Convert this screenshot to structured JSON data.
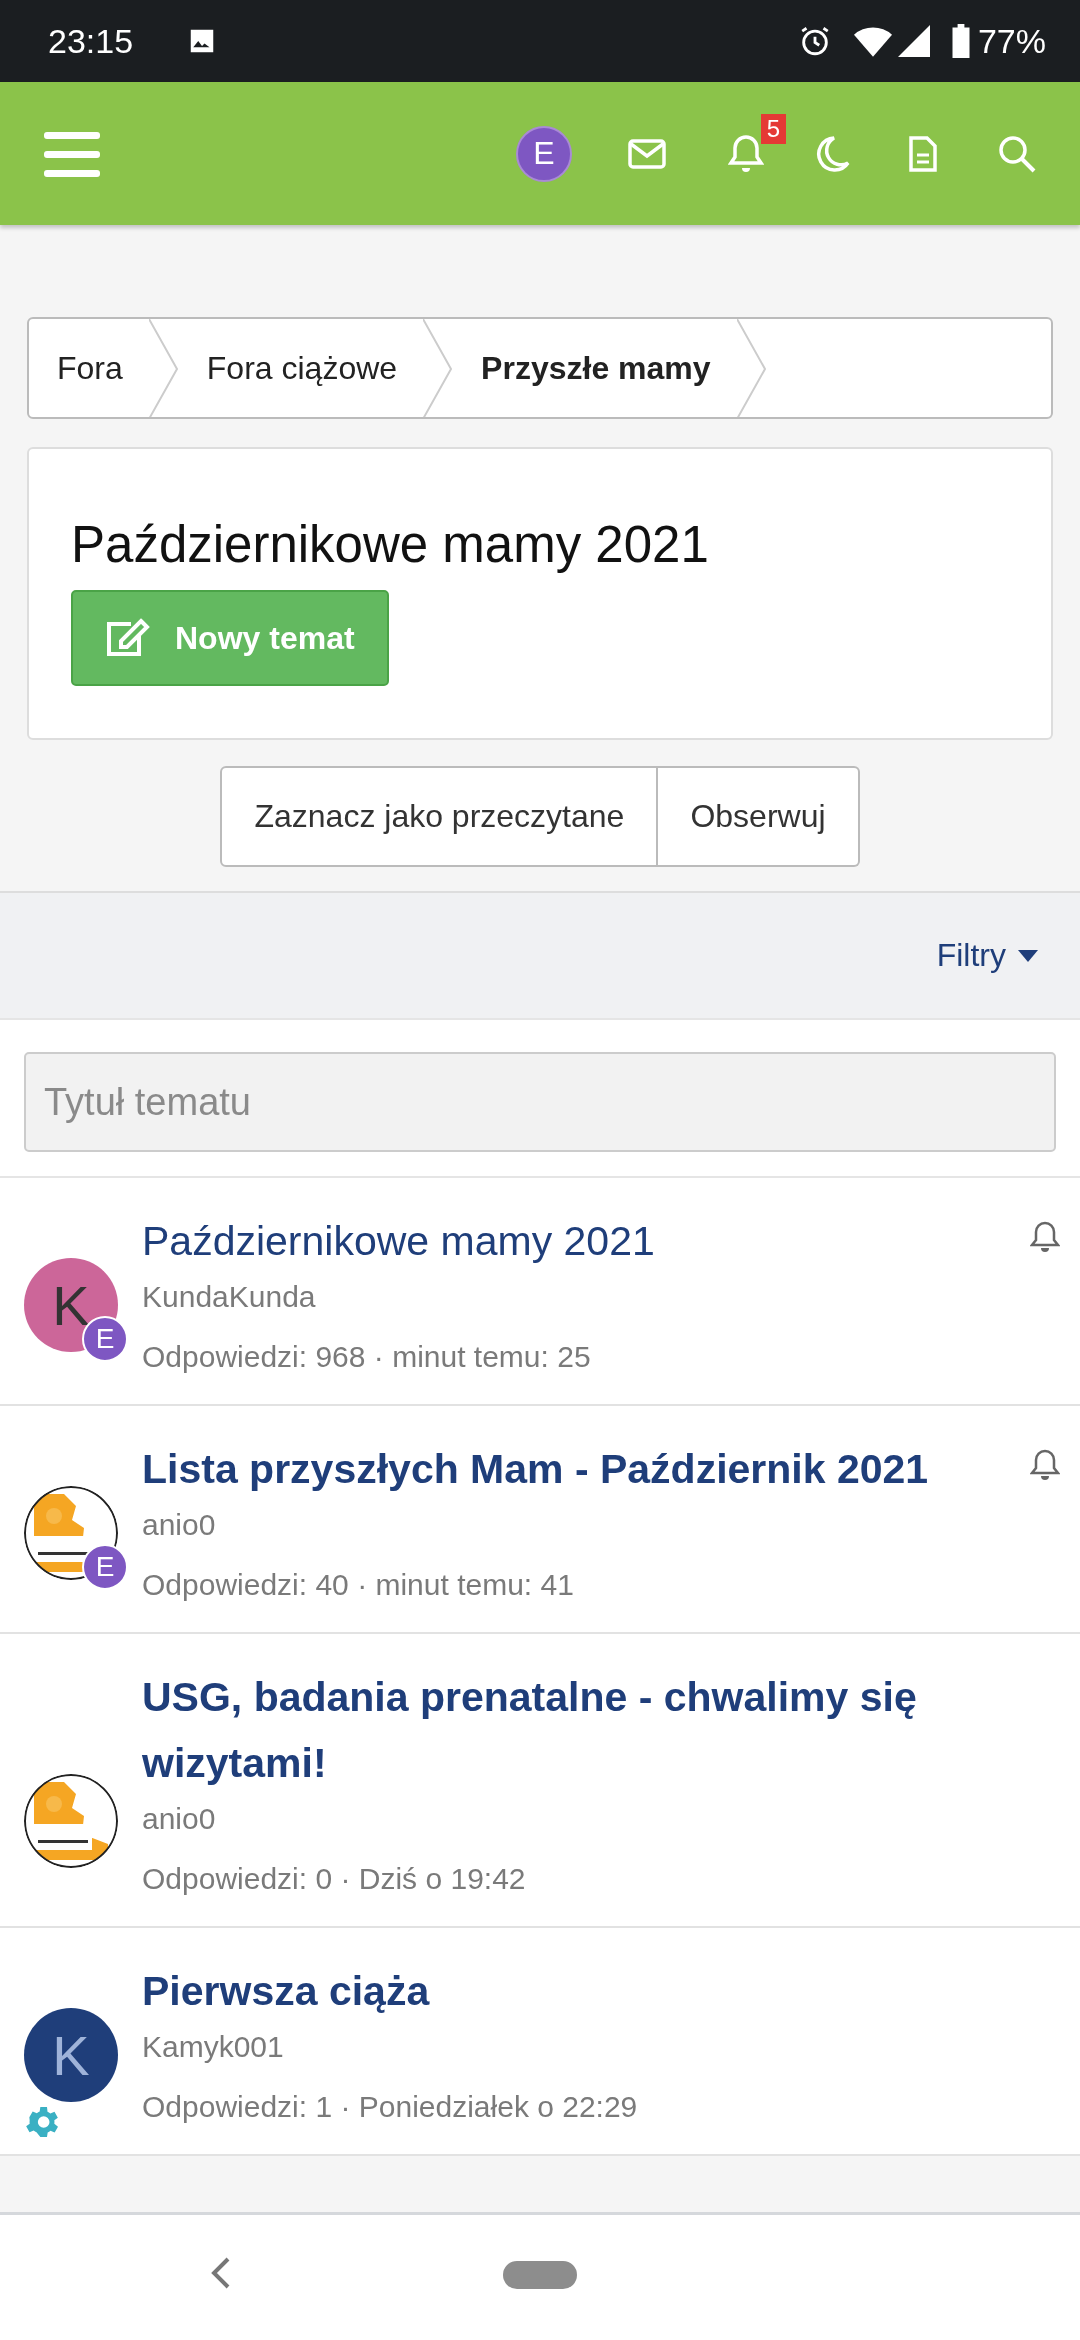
{
  "status_bar": {
    "time": "23:15",
    "battery": "77%"
  },
  "header": {
    "avatar_letter": "E",
    "notifications": "5"
  },
  "breadcrumbs": [
    {
      "label": "Fora",
      "current": false
    },
    {
      "label": "Fora ciążowe",
      "current": false
    },
    {
      "label": "Przyszłe mamy",
      "current": true
    }
  ],
  "forum": {
    "title": "Październikowe mamy 2021",
    "new_topic_button": "Nowy temat"
  },
  "actions": [
    "Zaznacz jako przeczytane",
    "Obserwuj"
  ],
  "filters": {
    "label": "Filtry"
  },
  "search": {
    "placeholder": "Tytuł tematu"
  },
  "threads": [
    {
      "title": "Październikowe mamy 2021",
      "unread": false,
      "watched": true,
      "author": "KundaKunda",
      "meta": "Odpowiedzi: 968 · minut temu: 25",
      "avatar": {
        "kind": "letter",
        "letter": "K",
        "color": "#cc6699"
      },
      "badge": "E",
      "moderator": false
    },
    {
      "title": "Lista przyszłych Mam - Październik 2021",
      "unread": true,
      "watched": true,
      "author": "anio0",
      "meta": "Odpowiedzi: 40 · minut temu: 41",
      "badge": "E",
      "moderator": false
    },
    {
      "title": "USG, badania prenatalne - chwalimy się wizytami!",
      "unread": true,
      "watched": false,
      "author": "anio0",
      "meta": "Odpowiedzi: 0 · Dziś o 19:42",
      "moderator": false
    },
    {
      "title": "Pierwsza ciąża",
      "unread": true,
      "watched": false,
      "author": "Kamyk001",
      "meta": "Odpowiedzi: 1 · Poniedziałek o 22:29",
      "avatar": {
        "kind": "letter",
        "letter": "K",
        "color": "#1f3e7a"
      },
      "moderator": true
    }
  ]
}
